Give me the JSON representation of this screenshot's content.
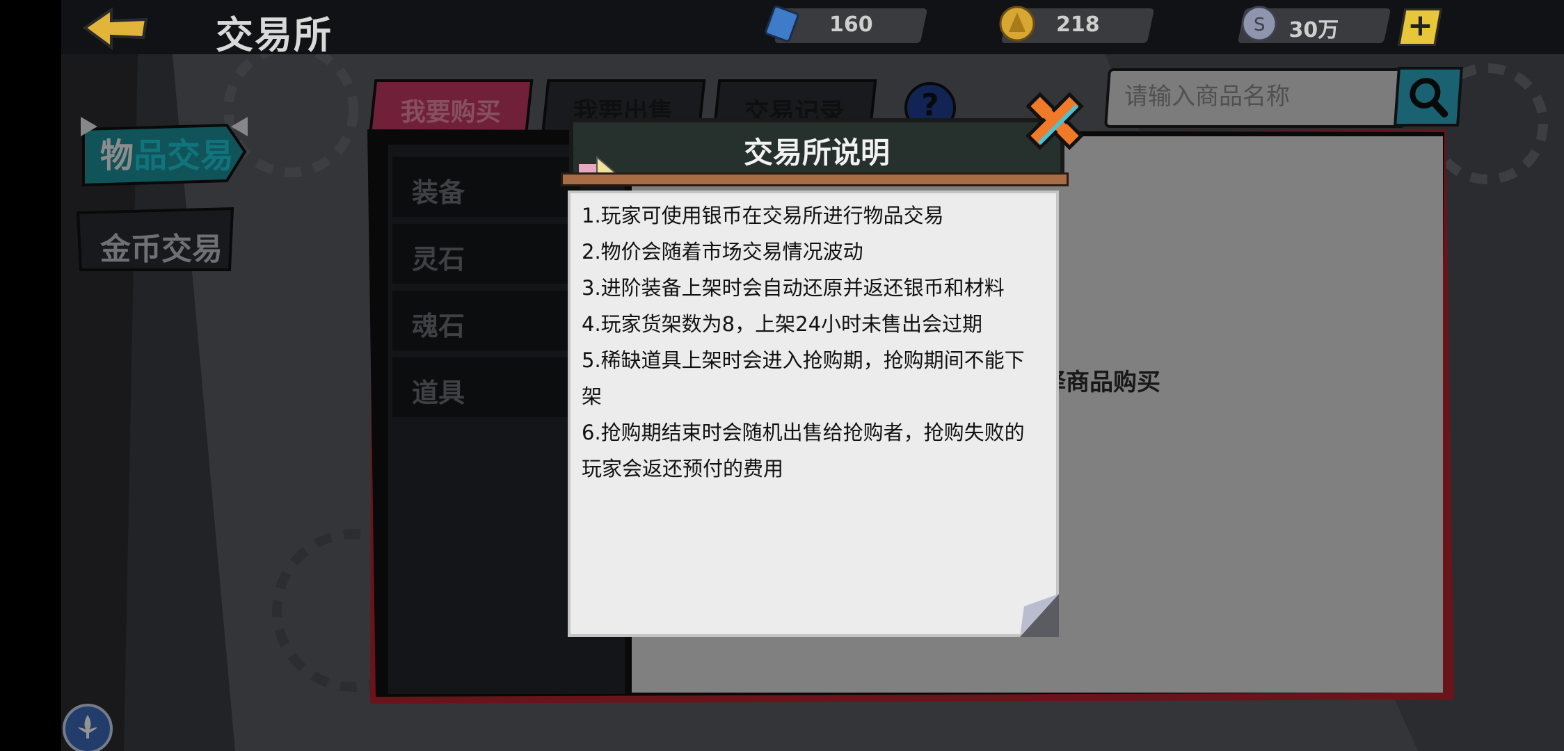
{
  "header": {
    "title": "交易所",
    "currencies": [
      {
        "name": "ticket",
        "value": "160"
      },
      {
        "name": "gold",
        "value": "218"
      },
      {
        "name": "silver",
        "value": "30万"
      }
    ],
    "add_label": "+"
  },
  "sidebar": {
    "items": [
      {
        "label_a": "物",
        "label_b": "品交易"
      },
      {
        "label": "金币交易"
      }
    ]
  },
  "tabs": [
    {
      "label": "我要购买"
    },
    {
      "label": "我要出售"
    },
    {
      "label": "交易记录"
    }
  ],
  "help_label": "?",
  "search": {
    "placeholder": "请输入商品名称"
  },
  "subcategories": [
    "装备",
    "灵石",
    "魂石",
    "道具"
  ],
  "main": {
    "empty_hint": "择商品购买"
  },
  "dialog": {
    "title": "交易所说明",
    "rules": [
      "1.玩家可使用银币在交易所进行物品交易",
      "2.物价会随着市场交易情况波动",
      "3.进阶装备上架时会自动还原并返还银币和材料",
      "4.玩家货架数为8，上架24小时未售出会过期",
      "5.稀缺道具上架时会进入抢购期，抢购期间不能下架",
      "6.抢购期结束时会随机出售给抢购者，抢购失败的玩家会返还预付的费用"
    ]
  },
  "colors": {
    "accent_teal": "#2fb7c7",
    "tab_active": "#c23a62",
    "close_orange": "#f07a2a"
  }
}
